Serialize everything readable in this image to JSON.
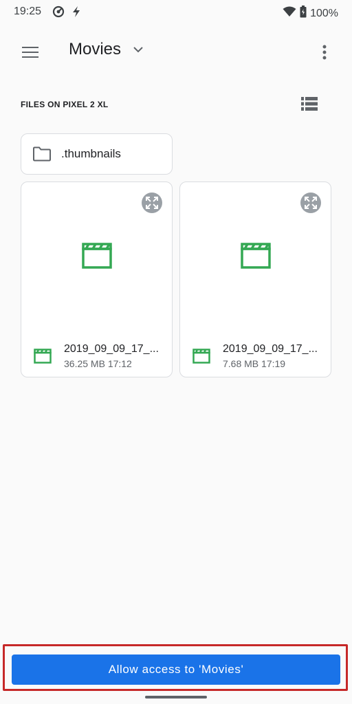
{
  "status_bar": {
    "time": "19:25",
    "battery": "100%",
    "icons": [
      "do-not-disturb-icon",
      "flash-icon",
      "wifi-icon",
      "battery-icon"
    ]
  },
  "app_bar": {
    "title": "Movies",
    "icons": [
      "menu-icon",
      "dropdown-arrow-icon",
      "more-vert-icon"
    ]
  },
  "section": {
    "label": "FILES ON PIXEL 2 XL",
    "view_icon": "list-view-icon"
  },
  "folders": [
    {
      "name": ".thumbnails",
      "icon": "folder-icon"
    }
  ],
  "files": [
    {
      "name": "2019_09_09_17_...",
      "size": "36.25 MB",
      "time": "17:12",
      "meta": "36.25 MB 17:12",
      "icon": "movie-icon"
    },
    {
      "name": "2019_09_09_17_...",
      "size": "7.68 MB",
      "time": "17:19",
      "meta": "7.68 MB 17:19",
      "icon": "movie-icon"
    }
  ],
  "action": {
    "label": "Allow access to 'Movies'"
  },
  "colors": {
    "accent": "#1a73e8",
    "movie_green": "#34a853",
    "highlight": "#c62828",
    "background": "#fafafa"
  }
}
